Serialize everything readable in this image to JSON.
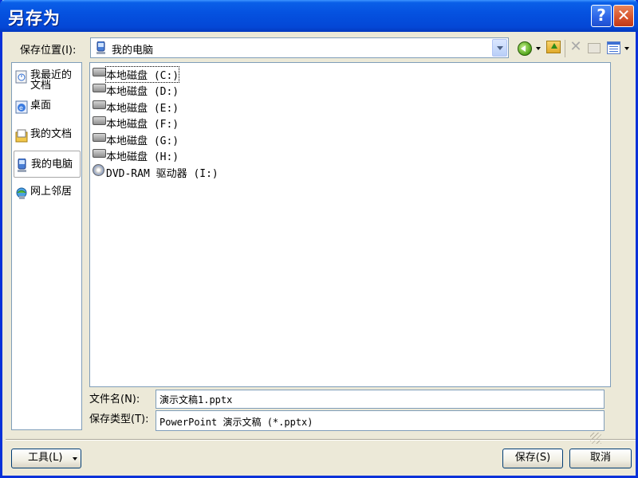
{
  "window": {
    "title": "另存为"
  },
  "title_buttons": {
    "help": "?",
    "close": "✕"
  },
  "location": {
    "label": "保存位置(I):",
    "value": "我的电脑"
  },
  "toolbar": {
    "back_icon": "back-icon",
    "up_icon": "up-folder-icon",
    "delete_icon": "delete-icon",
    "new_folder_icon": "new-folder-icon",
    "views_icon": "views-menu-icon"
  },
  "places": [
    {
      "label": "我最近的文档",
      "icon": "recent-documents-icon"
    },
    {
      "label": "桌面",
      "icon": "desktop-icon"
    },
    {
      "label": "我的文档",
      "icon": "my-documents-icon"
    },
    {
      "label": "我的电脑",
      "icon": "my-computer-icon",
      "selected": true
    },
    {
      "label": "网上邻居",
      "icon": "network-places-icon"
    }
  ],
  "files": [
    {
      "name": "本地磁盘 (C:)",
      "icon": "drive-icon"
    },
    {
      "name": "本地磁盘 (D:)",
      "icon": "drive-icon"
    },
    {
      "name": "本地磁盘 (E:)",
      "icon": "drive-icon"
    },
    {
      "name": "本地磁盘 (F:)",
      "icon": "drive-icon"
    },
    {
      "name": "本地磁盘 (G:)",
      "icon": "drive-icon"
    },
    {
      "name": "本地磁盘 (H:)",
      "icon": "drive-icon"
    },
    {
      "name": "DVD-RAM 驱动器 (I:)",
      "icon": "dvd-drive-icon"
    }
  ],
  "filename": {
    "label": "文件名(N):",
    "value": "演示文稿1.pptx"
  },
  "filetype": {
    "label": "保存类型(T):",
    "value": "PowerPoint 演示文稿 (*.pptx)"
  },
  "buttons": {
    "tools": "工具(L)",
    "save": "保存(S)",
    "cancel": "取消"
  },
  "colors": {
    "titlebar": "#0552e0",
    "window_bg": "#ece9d8",
    "border": "#7f9db9"
  }
}
